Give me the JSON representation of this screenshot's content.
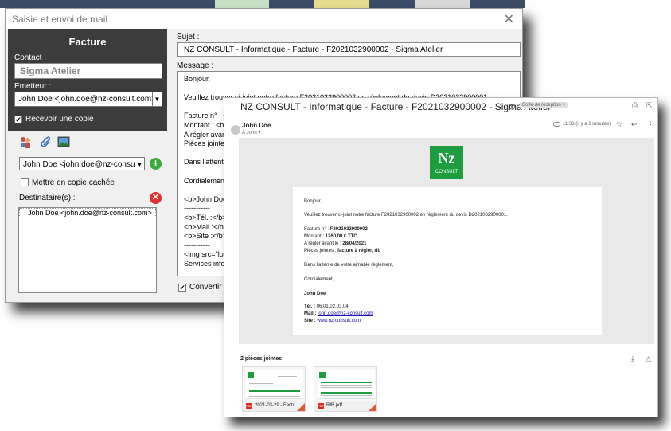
{
  "colors": {
    "left_panel_bg": "#3c3c3c",
    "add_green": "#3daa3d",
    "remove_red": "#e03030",
    "brand_green": "#1d9d3e",
    "link_blue": "#1a0dab"
  },
  "compose": {
    "title": "Saisie et envoi de mail",
    "close_icon": "close-icon",
    "left": {
      "heading": "Facture",
      "contact_label": "Contact :",
      "contact_value": "Sigma Atelier",
      "sender_label": "Emetteur :",
      "sender_value": "John Doe <john.doe@nz-consult.com>",
      "receive_copy_label": "Recevoir une copie",
      "receive_copy_checked": "✔",
      "attach_icons": [
        "contacts-icon",
        "paperclip-icon",
        "image-icon"
      ],
      "recipient_select_value": "John Doe <john.doe@nz-consult.com>",
      "bcc_label": "Mettre en copie cachée",
      "recipients_label": "Destinataire(s) :",
      "recipients": [
        "John Doe <john.doe@nz-consult.com>"
      ]
    },
    "right": {
      "subject_label": "Sujet :",
      "subject_value": "NZ CONSULT - Informatique - Facture - F2021032900002 - Sigma Atelier",
      "message_label": "Message :",
      "message_lines": [
        "Bonjour,",
        "",
        "Veuillez trouver ci-joint notre facture F2021032900002 en règlement du devis D2021032900001.",
        "",
        "Facture n° : <",
        "Montant : <b>",
        "A régler avant",
        "Pièces jointes",
        "",
        "Dans l'attente",
        "",
        "Cordialement,",
        "",
        "<b>John Doe<",
        "-----------",
        "<b>Tél. :</b>",
        "<b>Mail :</b>",
        "<b>Site :</b>",
        "-----------",
        "<img src=\"log",
        "Services infor"
      ],
      "convert_label": "Convertir les",
      "convert_checked": "✔"
    }
  },
  "preview": {
    "subject": "NZ CONSULT - Informatique - Facture - F2021032900002 - Sigma Atelier",
    "label": "Boîte de réception ×",
    "sender": "John Doe",
    "to": "À John ▾",
    "time": "11:33 (il y a 2 minutes)",
    "logo_main": "Nz",
    "logo_sub": "CONSULT",
    "body": {
      "greeting": "Bonjour,",
      "intro": "Veuillez trouver ci-joint notre facture F2021032900002 en règlement du devis D2021032900001.",
      "invoice_label": "Facture n° : ",
      "invoice_value": "F2021032900002",
      "amount_label": "Montant : ",
      "amount_value": "1260,00 € TTC",
      "due_label": "A régler avant le : ",
      "due_value": "28/04/2021",
      "attachments_label": "Pièces jointes : ",
      "attachments_value": "facture à régler, rib",
      "waiting": "Dans l'attente de votre aimable règlement,",
      "regards": "Cordialement,",
      "signature_name": "John Doe",
      "phone_label": "Tél. : ",
      "phone_value": "06.01.02.03.04",
      "mail_label": "Mail : ",
      "mail_value": "john.doe@nz-consult.com",
      "site_label": "Site : ",
      "site_value": "www.nz-consult.com"
    },
    "attachments_title": "2 pièces jointes",
    "attachments": [
      {
        "name": "2021-03-29 - Factu...",
        "type": "PDF"
      },
      {
        "name": "RIB.pdf",
        "type": "PDF"
      }
    ]
  }
}
